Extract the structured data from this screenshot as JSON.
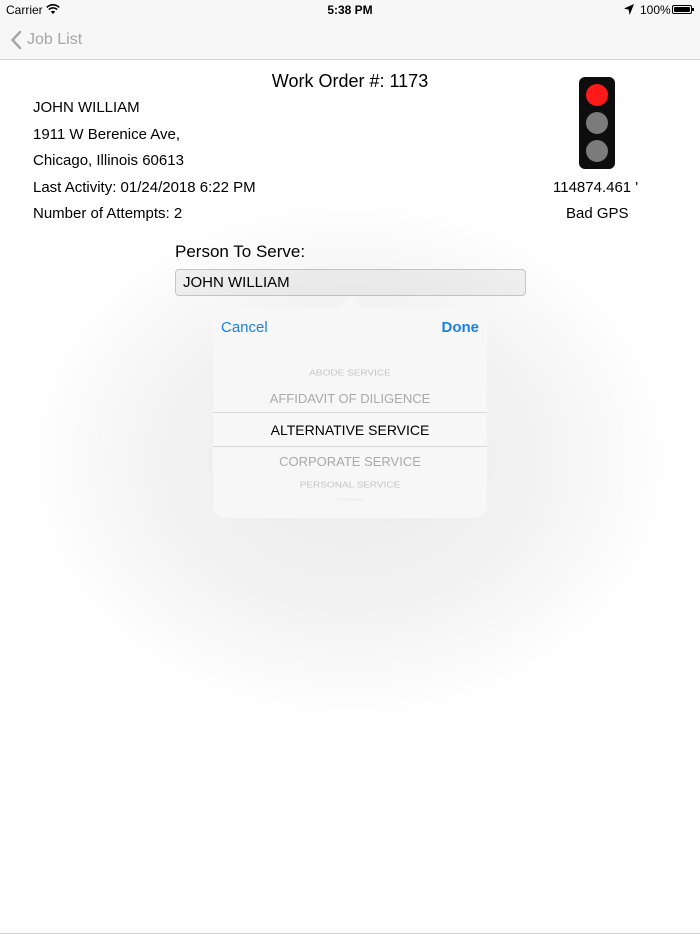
{
  "status_bar": {
    "carrier": "Carrier",
    "time": "5:38 PM",
    "battery": "100%"
  },
  "nav": {
    "back_label": "Job List"
  },
  "job": {
    "work_order": "Work Order #: 1173",
    "name": "JOHN WILLIAM",
    "address_line1": "1911 W Berenice Ave,",
    "address_line2": "Chicago, Illinois 60613",
    "last_activity": "Last Activity: 01/24/2018 6:22 PM",
    "attempts": "Number of Attempts: 2",
    "distance": "114874.461 '",
    "gps_status": "Bad GPS",
    "signal_state": "red",
    "signal_colors": {
      "active_red": "#ff1a1a",
      "inactive": "#7b7b7b",
      "housing": "#0d0d0d"
    }
  },
  "person_to_serve": {
    "label": "Person To Serve:",
    "value": "JOHN WILLIAM"
  },
  "picker": {
    "cancel_label": "Cancel",
    "done_label": "Done",
    "accent_color": "#1a7fe8",
    "selected": "ALTERNATIVE SERVICE",
    "options": [
      "ABODE SERVICE",
      "AFFIDAVIT OF DILIGENCE",
      "ALTERNATIVE SERVICE",
      "CORPORATE SERVICE",
      "PERSONAL SERVICE",
      "POSTING"
    ]
  }
}
